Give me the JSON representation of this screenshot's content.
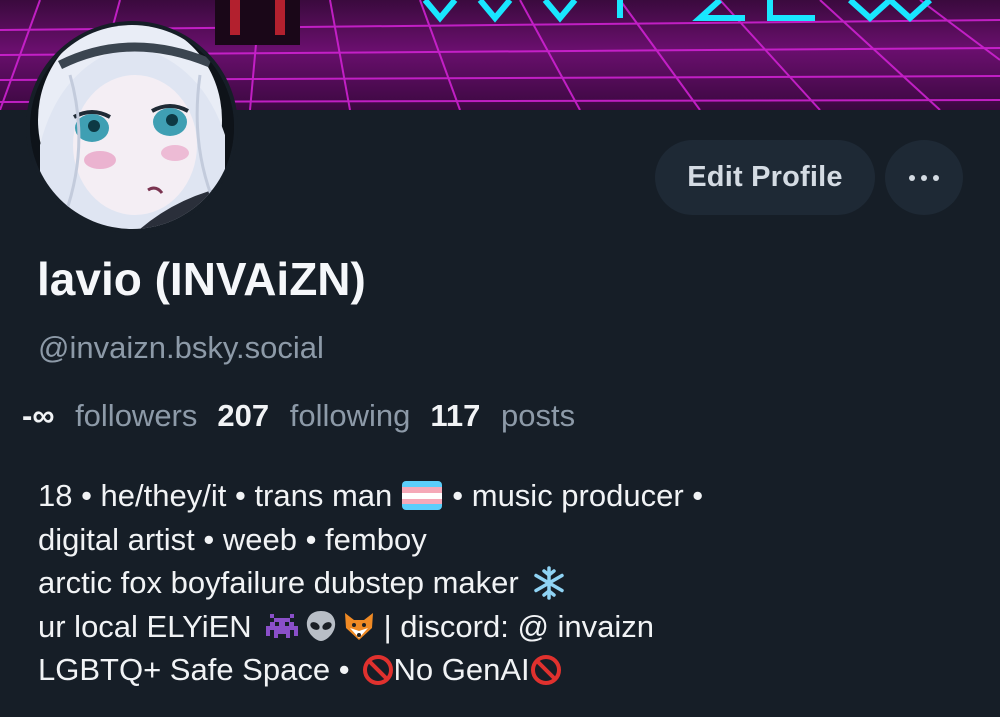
{
  "profile": {
    "display_name": "lavio (INVAiZN)",
    "handle": "@invaizn.bsky.social"
  },
  "actions": {
    "edit_profile": "Edit Profile"
  },
  "stats": {
    "followers_count": "-∞",
    "followers_label": "followers",
    "following_count": "207",
    "following_label": "following",
    "posts_count": "117",
    "posts_label": "posts"
  },
  "bio": {
    "line1_a": "18 • he/they/it • trans man",
    "line1_b": "• music producer •",
    "line2": "digital artist • weeb • femboy",
    "line3": "arctic fox boyfailure dubstep maker",
    "line4_a": "ur local ELYiEN",
    "line4_b": "| discord: @ invaizn",
    "line5_a": "LGBTQ+ Safe Space •",
    "line5_b": "No GenAI"
  },
  "icons": {
    "more": "ellipsis-icon",
    "trans_flag": "trans-flag-emoji",
    "snowflake": "snowflake-emoji",
    "alien_monster": "alien-monster-emoji",
    "alien": "alien-emoji",
    "fox": "fox-emoji",
    "prohibited": "prohibited-emoji"
  },
  "colors": {
    "background": "#161e27",
    "button_bg": "#1e2935",
    "muted_text": "#8d9aa8",
    "banner_magenta": "#c41bc9",
    "banner_cyan": "#19e6ff"
  }
}
